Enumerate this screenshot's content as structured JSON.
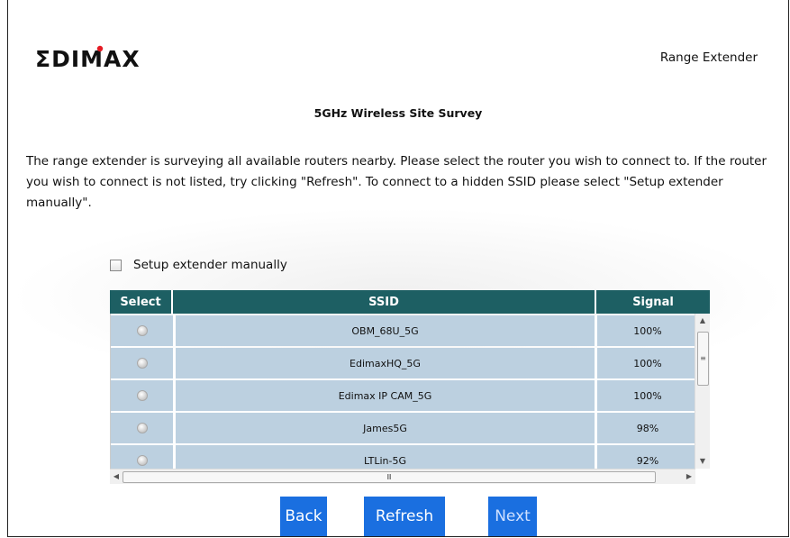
{
  "brand": {
    "logo_text": "EDIMAX",
    "accent": "#e51b24"
  },
  "header": {
    "product": "Range Extender"
  },
  "page": {
    "title": "5GHz Wireless Site Survey",
    "description": "The range extender is surveying all available routers nearby. Please select the router you wish to connect to. If the router you wish to connect is not listed, try clicking \"Refresh\". To connect to a hidden SSID please select \"Setup extender manually\".",
    "manual_label": "Setup extender manually"
  },
  "table": {
    "headers": {
      "select": "Select",
      "ssid": "SSID",
      "signal": "Signal"
    },
    "rows": [
      {
        "ssid": "OBM_68U_5G",
        "signal": "100%"
      },
      {
        "ssid": "EdimaxHQ_5G",
        "signal": "100%"
      },
      {
        "ssid": "Edimax IP CAM_5G",
        "signal": "100%"
      },
      {
        "ssid": "James5G",
        "signal": "98%"
      },
      {
        "ssid": "LTLin-5G",
        "signal": "92%"
      }
    ],
    "header_color": "#1d5f63",
    "row_color": "#bcd0e0"
  },
  "buttons": {
    "back": "Back",
    "refresh": "Refresh",
    "next": "Next",
    "color": "#1a6fe0"
  }
}
